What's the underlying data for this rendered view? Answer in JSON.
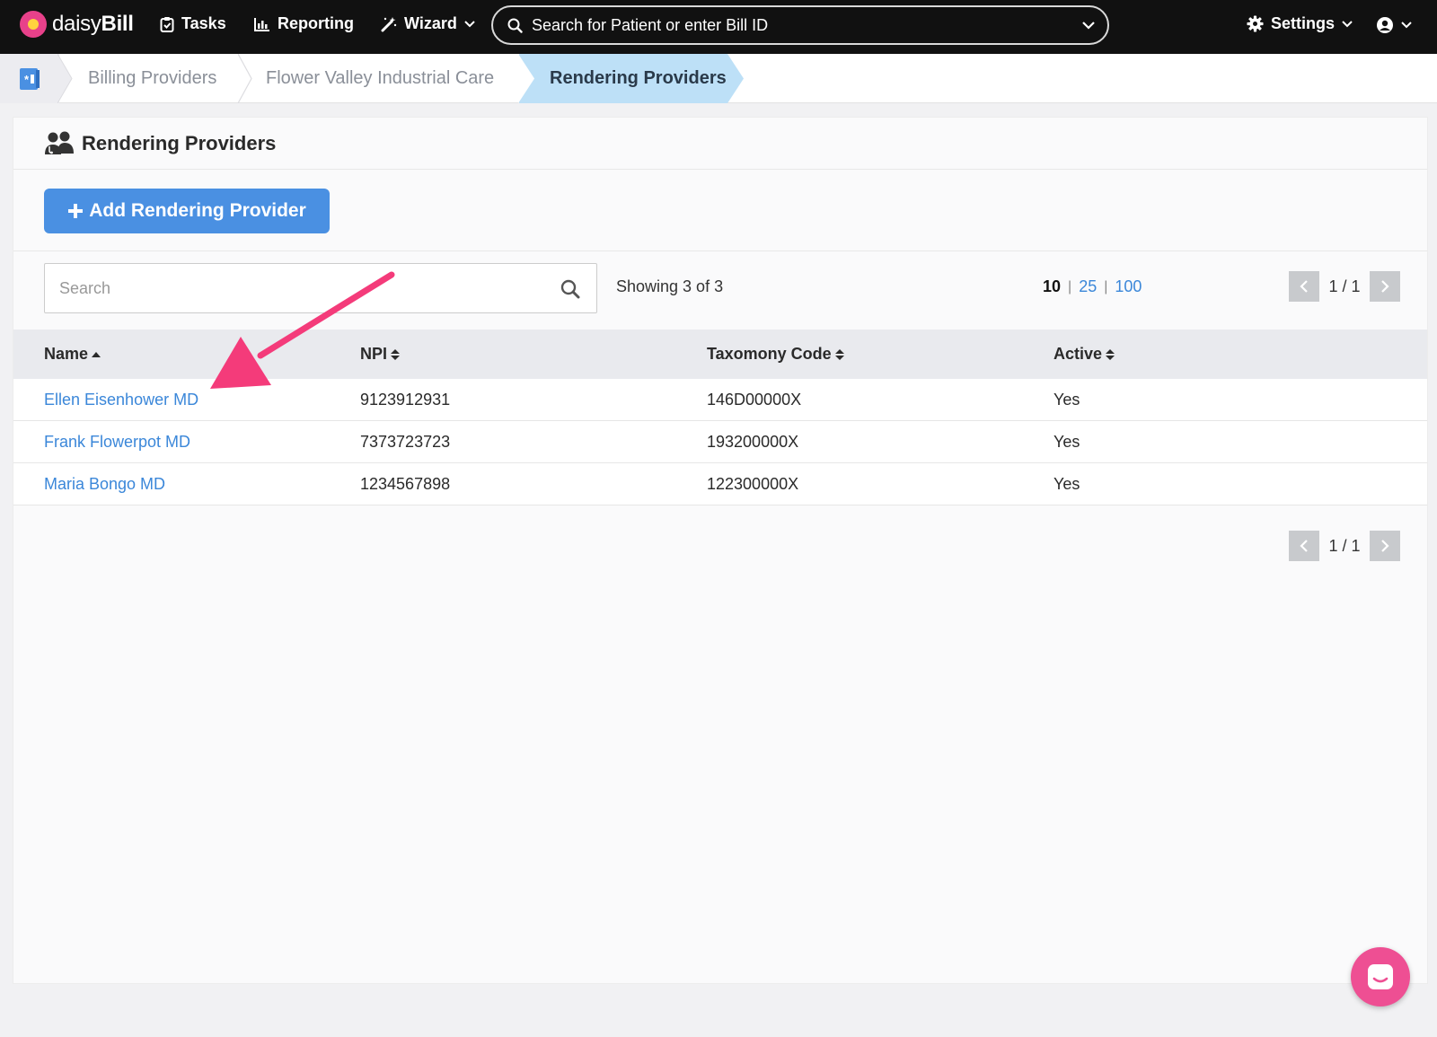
{
  "app": {
    "brand_light": "daisy",
    "brand_bold": "Bill"
  },
  "nav": {
    "tasks": "Tasks",
    "reporting": "Reporting",
    "wizard": "Wizard",
    "search_text": "Search for Patient or enter Bill ID",
    "settings": "Settings"
  },
  "breadcrumb": [
    "Billing Providers",
    "Flower Valley Industrial Care",
    "Rendering Providers"
  ],
  "page": {
    "title": "Rendering Providers",
    "add_button": "Add Rendering Provider",
    "search_placeholder": "Search",
    "showing": "Showing 3 of 3",
    "per_page": {
      "current": "10",
      "options": [
        "25",
        "100"
      ]
    },
    "pager": "1 / 1"
  },
  "table": {
    "columns": [
      "Name",
      "NPI",
      "Taxomony Code",
      "Active"
    ],
    "rows": [
      {
        "name": "Ellen Eisenhower MD",
        "npi": "9123912931",
        "taxonomy": "146D00000X",
        "active": "Yes"
      },
      {
        "name": "Frank Flowerpot MD",
        "npi": "7373723723",
        "taxonomy": "193200000X",
        "active": "Yes"
      },
      {
        "name": "Maria Bongo MD",
        "npi": "1234567898",
        "taxonomy": "122300000X",
        "active": "Yes"
      }
    ]
  },
  "colors": {
    "accent": "#4a90e2",
    "link": "#3b87d9",
    "arrow": "#f43b7a",
    "chat": "#ee4f93",
    "crumb_active": "#bde0f7"
  }
}
